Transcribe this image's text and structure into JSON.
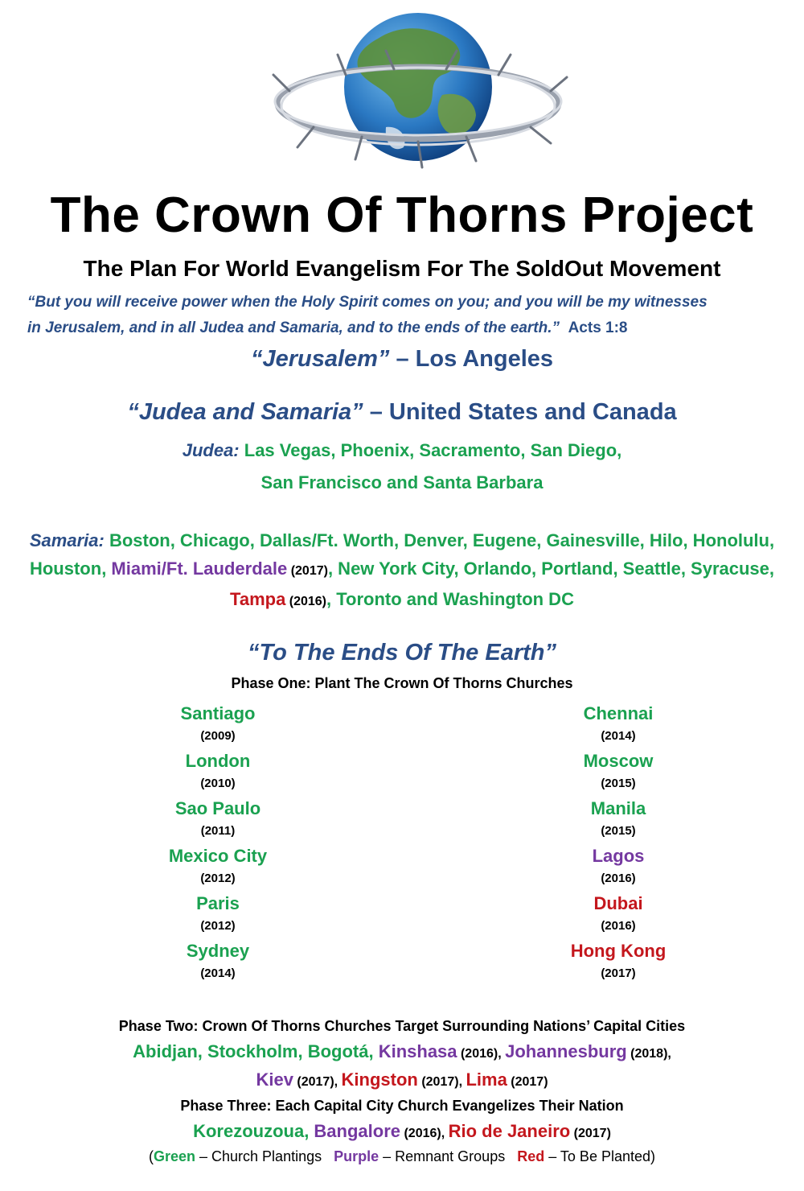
{
  "header": {
    "title": "The Crown Of Thorns Project",
    "subtitle": "The Plan For World Evangelism For The SoldOut Movement",
    "quote_line1": "“But you will receive power when the Holy Spirit comes on you; and you will be my witnesses",
    "quote_line2": "in Jerusalem, and in all Judea and Samaria, and to the ends of the earth.”",
    "quote_ref": "Acts 1:8"
  },
  "jerusalem": {
    "label": "“Jerusalem”",
    "value": " – Los Angeles"
  },
  "judea_samaria": {
    "label": "“Judea and Samaria”",
    "value": " – United States and Canada"
  },
  "judea": {
    "label": "Judea:",
    "line1": " Las Vegas, Phoenix, Sacramento, San Diego,",
    "line2": "San Francisco and Santa Barbara"
  },
  "samaria": {
    "label": "Samaria:",
    "part1": " Boston, Chicago, Dallas/Ft. Worth, Denver, Eugene, Gainesville, Hilo, Honolulu, Houston, ",
    "miami": "Miami/Ft. Lauderdale",
    "miami_year": " (2017)",
    "part2": ", New York City, Orlando, Portland, Seattle, Syracuse, ",
    "tampa": "Tampa",
    "tampa_year": " (2016)",
    "part3": ", Toronto and Washington DC"
  },
  "ends": {
    "label": "“To The Ends Of The Earth”",
    "phase_one": "Phase One: Plant The Crown Of Thorns Churches",
    "left": [
      {
        "city": "Santiago",
        "year": "(2009)",
        "status": "green"
      },
      {
        "city": "London",
        "year": "(2010)",
        "status": "green"
      },
      {
        "city": "Sao Paulo",
        "year": "(2011)",
        "status": "green"
      },
      {
        "city": "Mexico City",
        "year": "(2012)",
        "status": "green"
      },
      {
        "city": "Paris",
        "year": "(2012)",
        "status": "green"
      },
      {
        "city": "Sydney",
        "year": "(2014)",
        "status": "green"
      }
    ],
    "right": [
      {
        "city": "Chennai",
        "year": "(2014)",
        "status": "green"
      },
      {
        "city": "Moscow",
        "year": "(2015)",
        "status": "green"
      },
      {
        "city": "Manila",
        "year": "(2015)",
        "status": "green"
      },
      {
        "city": "Lagos",
        "year": "(2016)",
        "status": "purple"
      },
      {
        "city": "Dubai",
        "year": "(2016)",
        "status": "red"
      },
      {
        "city": "Hong Kong",
        "year": "(2017)",
        "status": "red"
      }
    ]
  },
  "phase_two": {
    "label": "Phase Two: Crown Of Thorns Churches Target Surrounding Nations’ Capital Cities",
    "green": "Abidjan, Stockholm, Bogotá, ",
    "kinshasa": "Kinshasa",
    "kinshasa_year": " (2016), ",
    "johannesburg": "Johannesburg",
    "johannesburg_year": " (2018),",
    "kiev": "Kiev",
    "kiev_year": " (2017), ",
    "kingston": "Kingston",
    "kingston_year": " (2017), ",
    "lima": "Lima",
    "lima_year": " (2017)"
  },
  "phase_three": {
    "label": "Phase Three: Each Capital City Church Evangelizes Their Nation",
    "green": "Korezouzoua, ",
    "bangalore": "Bangalore",
    "bangalore_year": " (2016), ",
    "rio": "Rio de Janeiro",
    "rio_year": " (2017)"
  },
  "legend": {
    "open": "(",
    "green": "Green",
    "green_text": " – Church Plantings   ",
    "purple": "Purple",
    "purple_text": " – Remnant Groups   ",
    "red": "Red",
    "red_text": " – To Be Planted)"
  },
  "colors": {
    "navy": "#2a4d86",
    "green": "#1aa150",
    "purple": "#7438a0",
    "red": "#c4171d"
  }
}
